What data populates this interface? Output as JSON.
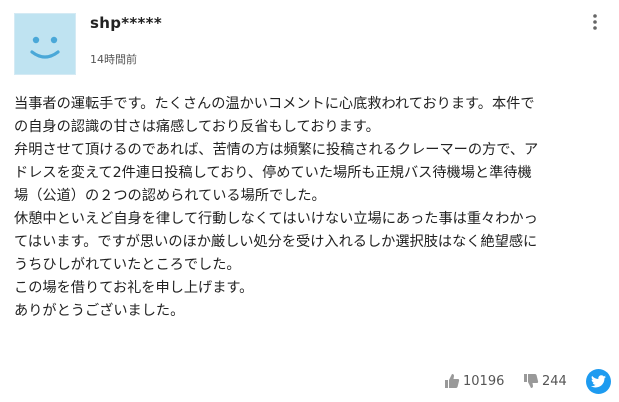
{
  "comment": {
    "username": "shp*****",
    "timestamp": "14時間前",
    "avatar_icon": "smiley-face-icon",
    "more_icon": "more-vertical-icon",
    "body_lines": [
      "当事者の運転手です。たくさんの温かいコメントに心底救われております。本件で",
      "の自身の認識の甘さは痛感しており反省もしております。",
      "弁明させて頂けるのであれば、苦情の方は頻繁に投稿されるクレーマーの方で、ア",
      "ドレスを変えて2件連日投稿しており、停めていた場所も正規バス待機場と準待機",
      "場（公道）の２つの認められている場所でした。",
      "休憩中といえど自身を律して行動しなくてはいけない立場にあった事は重々わかっ",
      "てはいます。ですが思いのほか厳しい処分を受け入れるしか選択肢はなく絶望感に",
      "うちひしがれていたところでした。",
      "この場を借りてお礼を申し上げます。",
      "ありがとうございました。"
    ],
    "likes": "10196",
    "dislikes": "244",
    "like_icon": "thumbs-up-icon",
    "dislike_icon": "thumbs-down-icon",
    "share_icon": "twitter-icon"
  },
  "colors": {
    "avatar_bg": "#bfe3f1",
    "avatar_face": "#4aa8d8",
    "twitter": "#1d9bf0",
    "text": "#222222",
    "muted": "#555555"
  }
}
